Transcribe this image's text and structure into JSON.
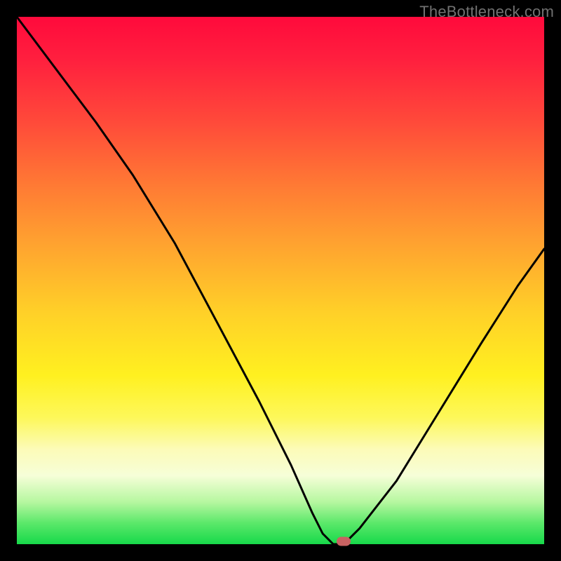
{
  "watermark": "TheBottleneck.com",
  "colors": {
    "frame": "#000000",
    "curve": "#000000",
    "marker": "#c96262",
    "gradient_top": "#ff0a3c",
    "gradient_bottom": "#17d94a"
  },
  "chart_data": {
    "type": "line",
    "title": "",
    "xlabel": "",
    "ylabel": "",
    "xlim": [
      0,
      100
    ],
    "ylim": [
      0,
      100
    ],
    "annotations": [
      {
        "type": "marker",
        "x": 62,
        "y": 0
      }
    ],
    "series": [
      {
        "name": "bottleneck-curve",
        "x": [
          0,
          6,
          15,
          22,
          30,
          38,
          46,
          52,
          56,
          58,
          60,
          62,
          65,
          72,
          80,
          88,
          95,
          100
        ],
        "values": [
          100,
          92,
          80,
          70,
          57,
          42,
          27,
          15,
          6,
          2,
          0,
          0,
          3,
          12,
          25,
          38,
          49,
          56
        ]
      }
    ]
  }
}
